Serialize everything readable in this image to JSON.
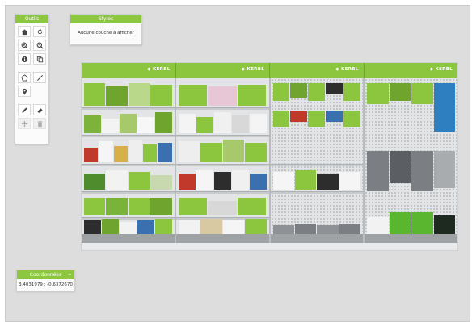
{
  "tools_panel": {
    "title": "Outils",
    "collapse": "–",
    "buttons": [
      {
        "name": "home-icon",
        "label": "Accueil"
      },
      {
        "name": "refresh-icon",
        "label": "Actualiser"
      },
      {
        "name": "zoom-in-icon",
        "label": "Zoom avant"
      },
      {
        "name": "zoom-out-icon",
        "label": "Zoom arrière"
      },
      {
        "name": "info-icon",
        "label": "Informations"
      },
      {
        "name": "copy-icon",
        "label": "Copier"
      },
      {
        "name": "polygon-icon",
        "label": "Polygone"
      },
      {
        "name": "line-icon",
        "label": "Ligne"
      },
      {
        "name": "marker-icon",
        "label": "Point"
      },
      {
        "name": "pencil-icon",
        "label": "Dessin"
      },
      {
        "name": "eraser-icon",
        "label": "Gomme"
      },
      {
        "name": "move-icon",
        "label": "Déplacer"
      },
      {
        "name": "trash-icon",
        "label": "Supprimer"
      }
    ]
  },
  "styles_panel": {
    "title": "Styles",
    "collapse": "–",
    "empty_message": "Aucune couche à afficher"
  },
  "coords_panel": {
    "title": "Coordonnées",
    "collapse": "–",
    "value": "3.4031979 ; -0.6372670"
  },
  "image": {
    "brand": "KERBL",
    "accent_color": "#8dc63f"
  }
}
